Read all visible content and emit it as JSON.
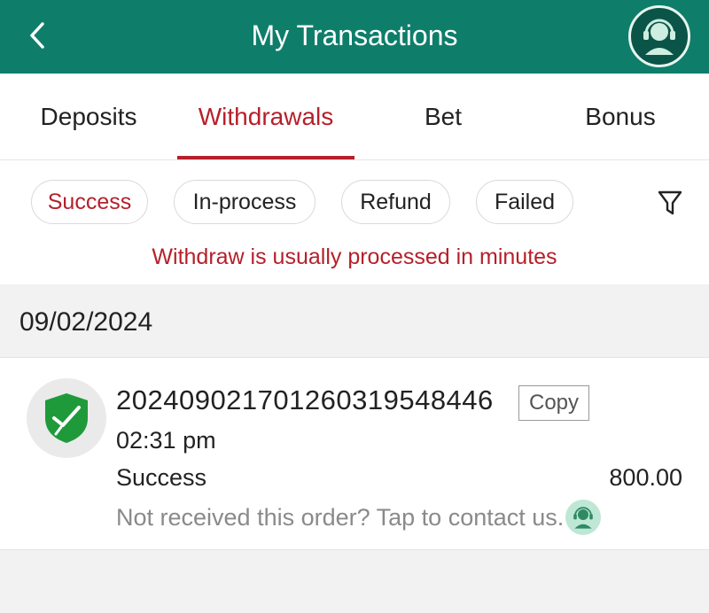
{
  "header": {
    "title": "My Transactions",
    "back_icon": "chevron-left-icon",
    "support_icon": "customer-support-icon",
    "brand_color": "#0e7e6b"
  },
  "tabs": [
    {
      "label": "Deposits",
      "active": false
    },
    {
      "label": "Withdrawals",
      "active": true
    },
    {
      "label": "Bet",
      "active": false
    },
    {
      "label": "Bonus",
      "active": false
    }
  ],
  "filters": {
    "chips": [
      {
        "label": "Success",
        "active": true
      },
      {
        "label": "In-process",
        "active": false
      },
      {
        "label": "Refund",
        "active": false
      },
      {
        "label": "Failed",
        "active": false
      }
    ],
    "filter_icon": "filter-funnel-icon",
    "notice": "Withdraw is usually processed in minutes",
    "accent_color": "#b5202a"
  },
  "transactions": [
    {
      "date": "09/02/2024",
      "order_id": "20240902170126031954844​6",
      "copy_label": "Copy",
      "time": "02:31 pm",
      "status": "Success",
      "amount": "800.00",
      "contact_text": "Not received this order? Tap to contact us.",
      "status_icon": "green-shield-check-icon"
    }
  ]
}
